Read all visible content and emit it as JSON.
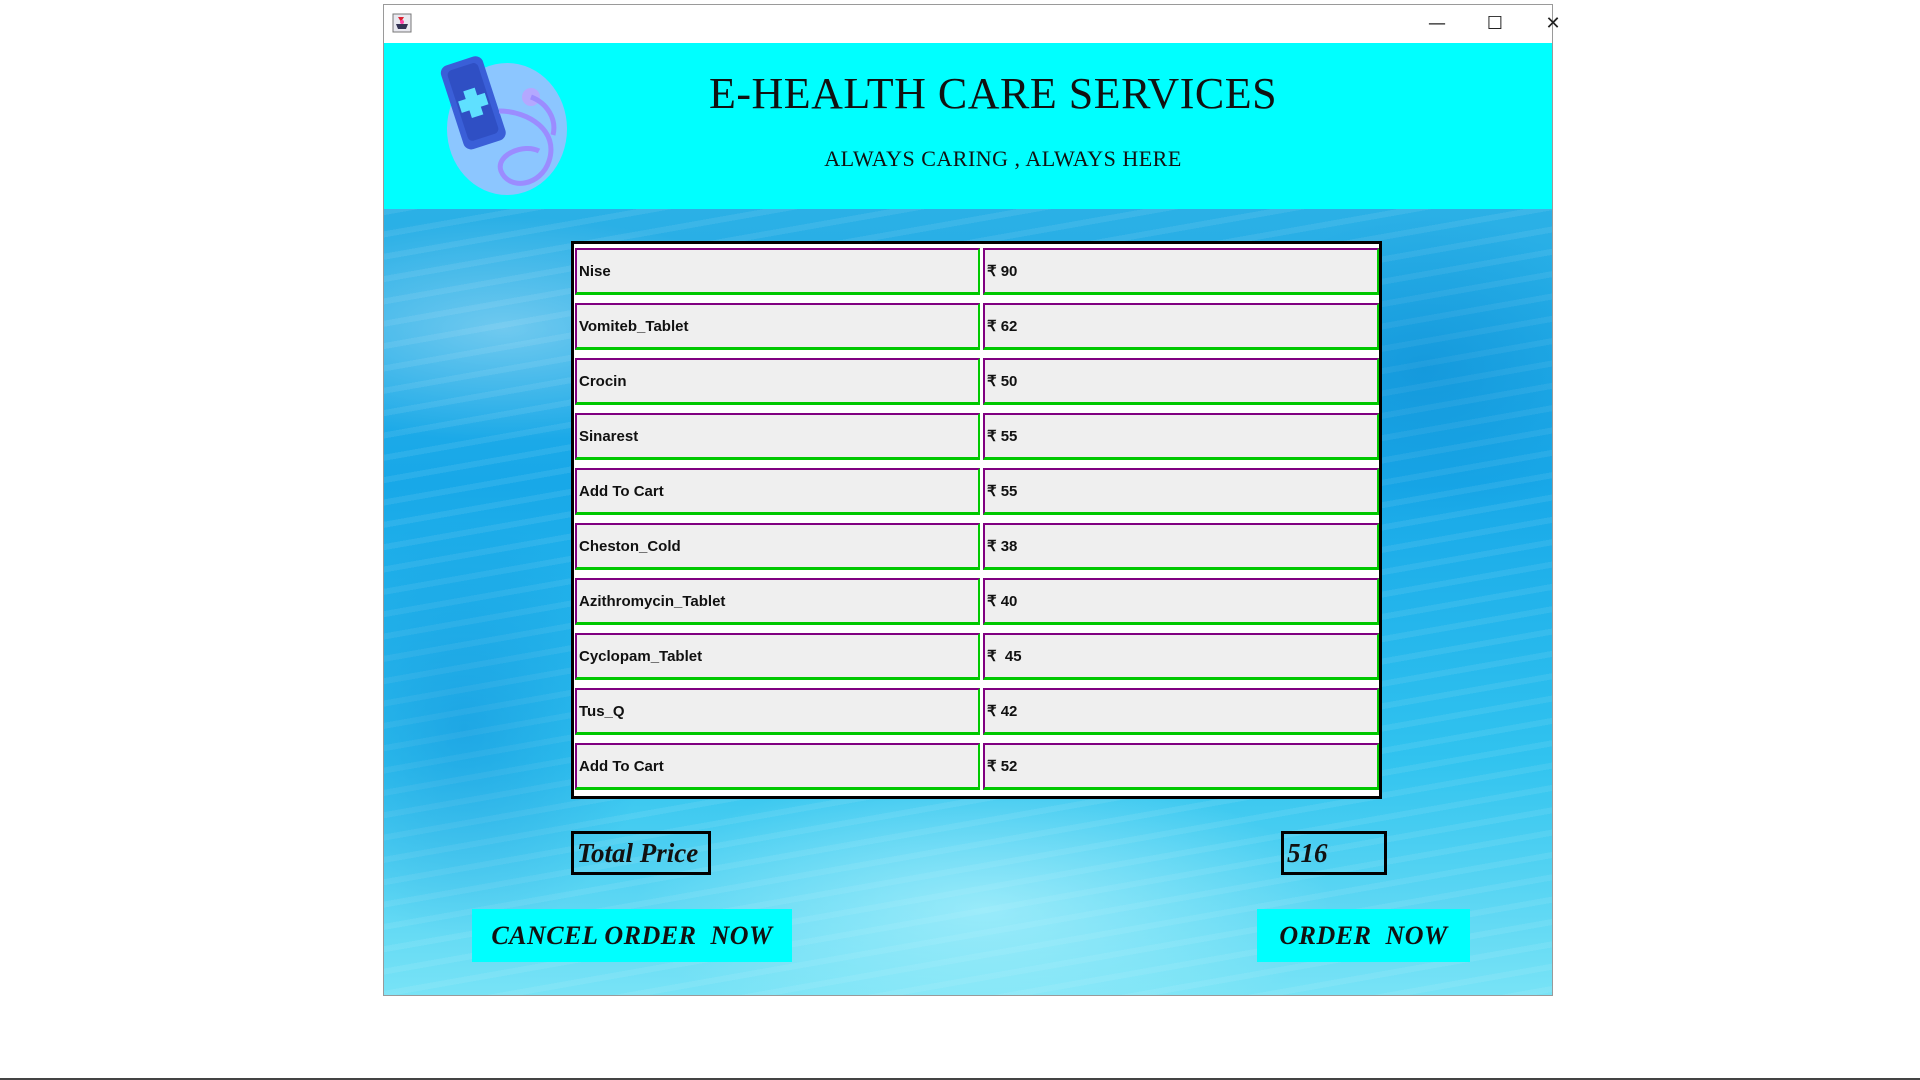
{
  "window": {
    "controls": {
      "minimize": "—",
      "maximize": "☐",
      "close": "✕"
    }
  },
  "header": {
    "title": "E-HEALTH CARE SERVICES",
    "tagline": "ALWAYS CARING , ALWAYS HERE",
    "logo_icon": "stethoscope-phone-icon"
  },
  "items": [
    {
      "name": "Nise",
      "price": "₹ 90"
    },
    {
      "name": "Vomiteb_Tablet",
      "price": "₹ 62"
    },
    {
      "name": "Crocin",
      "price": "₹ 50"
    },
    {
      "name": "Sinarest",
      "price": "₹ 55"
    },
    {
      "name": "Add To Cart",
      "price": "₹ 55"
    },
    {
      "name": "Cheston_Cold",
      "price": "₹ 38"
    },
    {
      "name": "Azithromycin_Tablet",
      "price": "₹ 40"
    },
    {
      "name": "Cyclopam_Tablet",
      "price": "₹  45"
    },
    {
      "name": "Tus_Q",
      "price": "₹ 42"
    },
    {
      "name": "Add To Cart",
      "price": "₹ 52"
    }
  ],
  "total": {
    "label": "Total Price",
    "value": "516"
  },
  "actions": {
    "cancel": "CANCEL ORDER  NOW",
    "order": "ORDER  NOW"
  },
  "colors": {
    "header_bg": "#00ffff",
    "button_bg": "#00ffff",
    "cell_border_top": "#800080",
    "cell_border_bottom": "#00c800"
  }
}
